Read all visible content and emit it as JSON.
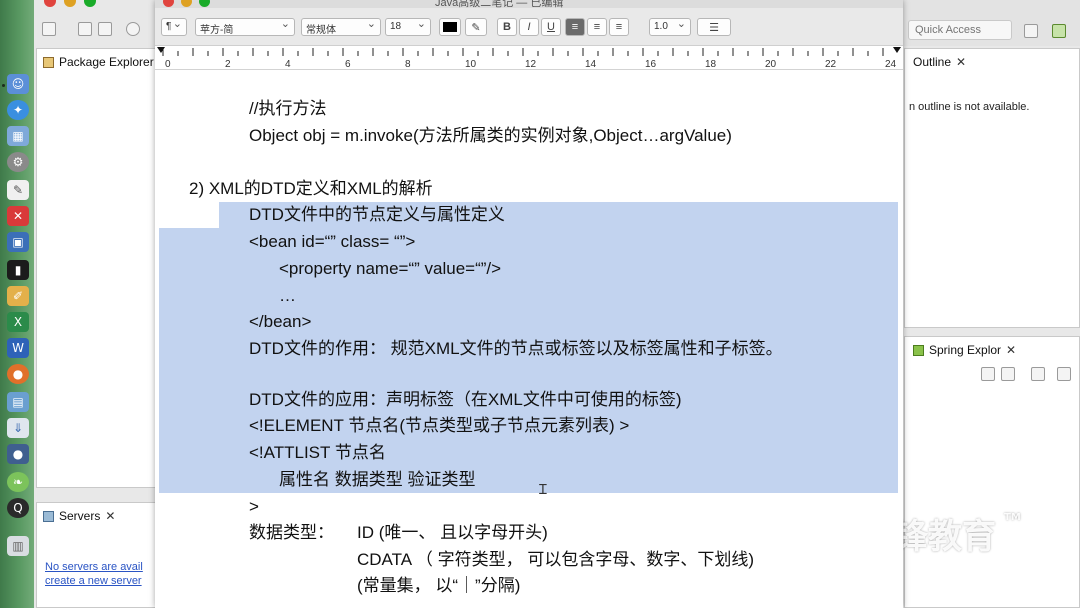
{
  "document": {
    "title": "Java高级二笔记 — 已编辑",
    "format": {
      "paragraph_style": "¶",
      "font_family": "苹方-简",
      "font_style": "常规体",
      "font_size": "18",
      "bold": "B",
      "italic": "I",
      "underline": "U",
      "line_spacing": "1.0"
    },
    "ruler_labels": [
      "0",
      "2",
      "4",
      "6",
      "8",
      "10",
      "12",
      "14",
      "16",
      "18",
      "20",
      "22",
      "24"
    ],
    "lines": [
      "//执行方法",
      "Object obj = m.invoke(方法所属类的实例对象,Object…argValue)",
      "2) XML的DTD定义和XML的解析",
      "DTD文件中的节点定义与属性定义",
      "<bean id=“” class= “”>",
      "<property name=“” value=“”/>",
      "…",
      "</bean>",
      "DTD文件的作用： 规范XML文件的节点或标签以及标签属性和子标签。",
      "DTD文件的应用：声明标签（在XML文件中可使用的标签)",
      "<!ELEMENT 节点名(节点类型或子节点元素列表) >",
      "<!ATTLIST 节点名",
      "属性名  数据类型  验证类型",
      ">",
      "数据类型：",
      "ID (唯一、 且以字母开头)",
      "CDATA （ 字符类型， 可以包含字母、数字、下划线)",
      "(常量集， 以“｜”分隔)"
    ]
  },
  "eclipse": {
    "package_explorer_tab": "Package Explorer",
    "servers_tab": "Servers",
    "servers_link_1": "No servers are avail",
    "servers_link_2": "create a new server",
    "quick_access_placeholder": "Quick Access",
    "outline_tab": "Outline",
    "outline_message": "n outline is not available.",
    "spring_explorer_tab": "Spring Explor"
  },
  "watermark": {
    "text": "千锋教育",
    "tm": "TM"
  },
  "colors": {
    "selection": "#c2d3ef",
    "dock": "#5a9a63",
    "link": "#2a54c4"
  }
}
